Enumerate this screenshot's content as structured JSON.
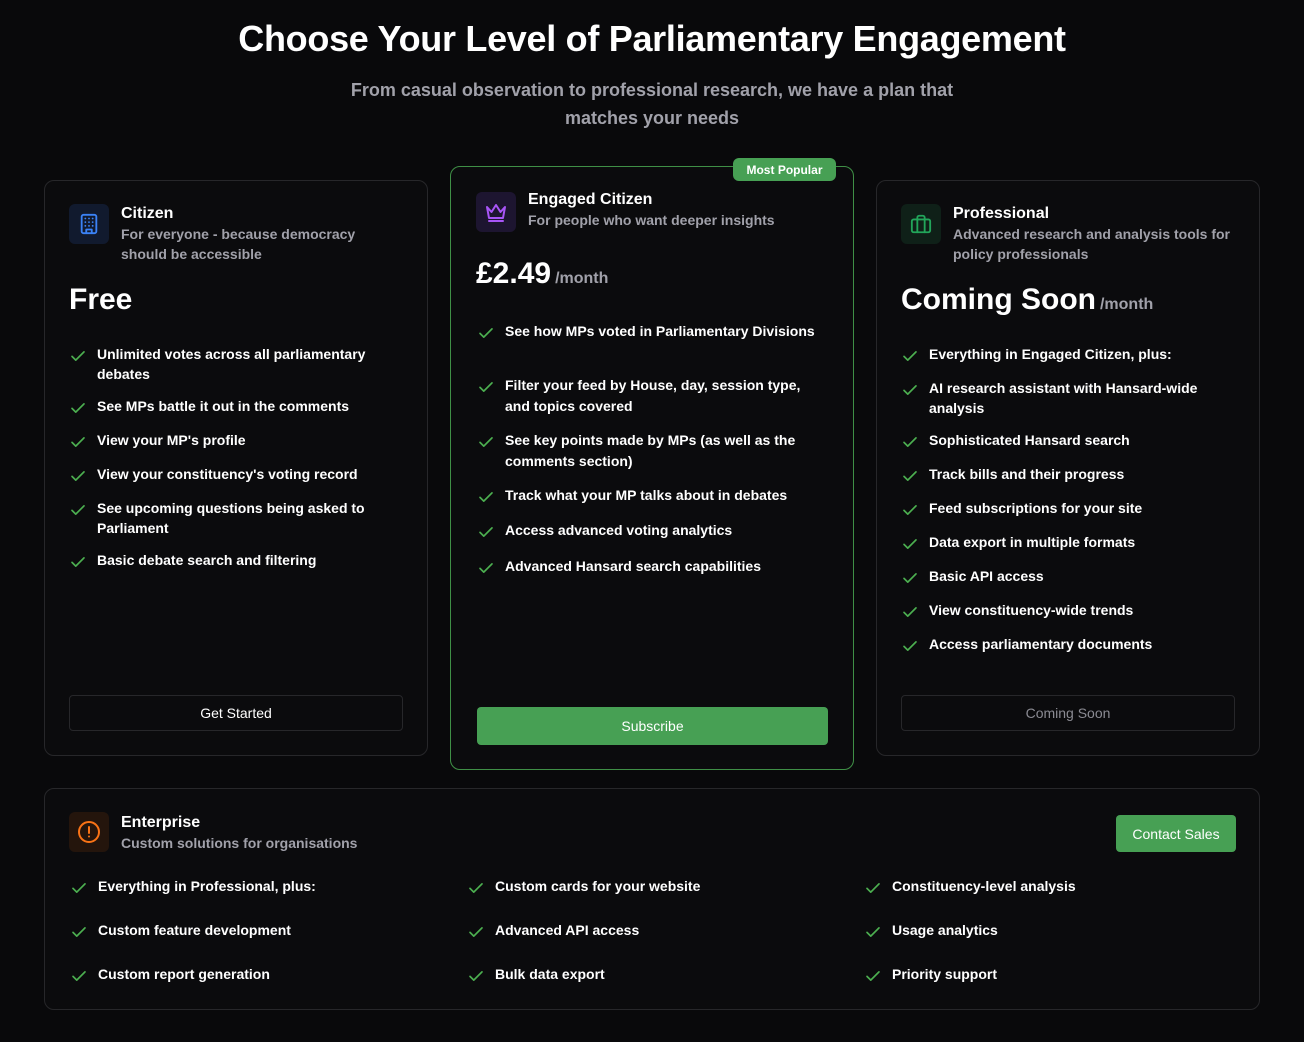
{
  "header": {
    "title": "Choose Your Level of Parliamentary Engagement",
    "subtitle": "From casual observation to professional research, we have a plan that matches your needs"
  },
  "colors": {
    "accent": "#47a054",
    "check": "#4caf50",
    "background": "#09090b",
    "citizen_icon": "#3b82f6",
    "engaged_icon": "#a855f7",
    "professional_icon": "#22a55a",
    "enterprise_icon": "#f97316"
  },
  "plans": {
    "citizen": {
      "icon": "building-icon",
      "name": "Citizen",
      "desc": "For everyone - because democracy should be accessible",
      "price": "Free",
      "features": [
        "Unlimited votes across all parliamentary debates",
        "See MPs battle it out in the comments",
        "View your MP's profile",
        "View your constituency's voting record",
        "See upcoming questions being asked to Parliament",
        "Basic debate search and filtering"
      ],
      "button": "Get Started"
    },
    "engaged": {
      "icon": "crown-icon",
      "badge": "Most Popular",
      "name": "Engaged Citizen",
      "desc": "For people who want deeper insights",
      "price": "£2.49",
      "period": "/month",
      "features": [
        "See how MPs voted in Parliamentary Divisions",
        "Filter your feed by House, day, session type, and topics covered",
        "See key points made by MPs (as well as the comments section)",
        "Track what your MP talks about in debates",
        "Access advanced voting analytics",
        "Advanced Hansard search capabilities"
      ],
      "button": "Subscribe"
    },
    "professional": {
      "icon": "briefcase-icon",
      "name": "Professional",
      "desc": "Advanced research and analysis tools for policy professionals",
      "price": "Coming Soon",
      "period": "/month",
      "features": [
        "Everything in Engaged Citizen, plus:",
        "AI research assistant with Hansard-wide analysis",
        "Sophisticated Hansard search",
        "Track bills and their progress",
        "Feed subscriptions for your site",
        "Data export in multiple formats",
        "Basic API access",
        "View constituency-wide trends",
        "Access parliamentary documents"
      ],
      "button": "Coming Soon"
    }
  },
  "enterprise": {
    "icon": "alert-circle-icon",
    "name": "Enterprise",
    "desc": "Custom solutions for organisations",
    "button": "Contact Sales",
    "features": [
      "Everything in Professional, plus:",
      "Custom cards for your website",
      "Constituency-level analysis",
      "Custom feature development",
      "Advanced API access",
      "Usage analytics",
      "Custom report generation",
      "Bulk data export",
      "Priority support"
    ]
  }
}
